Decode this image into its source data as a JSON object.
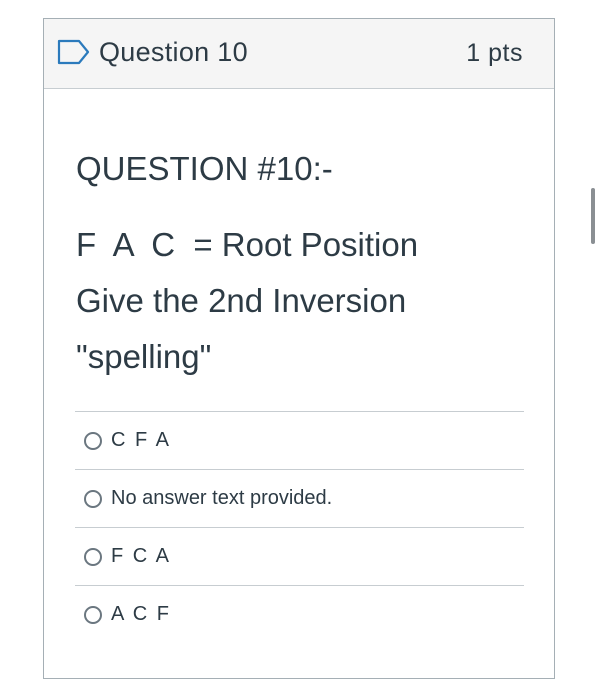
{
  "question": {
    "title": "Question 10",
    "points": "1 pts",
    "heading": "QUESTION #10:-",
    "prompt_line1": "F  A  C  = Root Position",
    "prompt_line2": "Give the 2nd Inversion",
    "prompt_line3": "\"spelling\""
  },
  "answers": [
    {
      "label": "C F A",
      "selected": false
    },
    {
      "label": "No answer text provided.",
      "selected": false
    },
    {
      "label": "F C A",
      "selected": false
    },
    {
      "label": "A C F",
      "selected": false
    }
  ],
  "icons": {
    "flag": "flag-icon"
  }
}
